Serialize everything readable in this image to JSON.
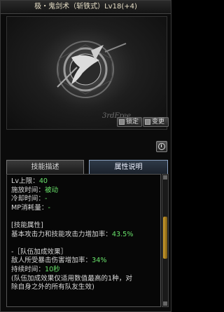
{
  "title": "极・鬼剑术（斩铁式）Lv18(+4)",
  "buttons": {
    "lock": "锁定",
    "swap": "变更"
  },
  "preview": {
    "icon": "sword-emblem-icon",
    "watermark": "3rdFree"
  },
  "tabs": {
    "skill_desc": "技能描述",
    "attr_desc": "属性说明",
    "active": "attr_desc"
  },
  "content": {
    "lines": [
      {
        "label": "Lv上限：",
        "value": "40"
      },
      {
        "label": "施放时间：",
        "value": "被动"
      },
      {
        "label": "冷却时间：",
        "value": "-"
      },
      {
        "label": "MP消耗量：",
        "value": "-"
      },
      {
        "label": "",
        "value": ""
      },
      {
        "label": "[技能属性]",
        "value": ""
      },
      {
        "label": "基本攻击力和技能攻击力增加率：",
        "value": "43.5%"
      },
      {
        "label": "",
        "value": ""
      },
      {
        "label": "-［队伍加成效果］",
        "value": ""
      },
      {
        "label": "敌人所受暴击伤害增加率：",
        "value": "34%"
      },
      {
        "label": "持续时间：",
        "value": "10秒"
      },
      {
        "label": "(队伍加成效果仅适用数值最高的1种，对",
        "value": ""
      },
      {
        "label": "除自身之外的所有队友生效)",
        "value": ""
      }
    ]
  },
  "colors": {
    "value_green": "#69e36b",
    "tab_active": "#2f3a48",
    "scroll_thumb": "#d0a030"
  }
}
